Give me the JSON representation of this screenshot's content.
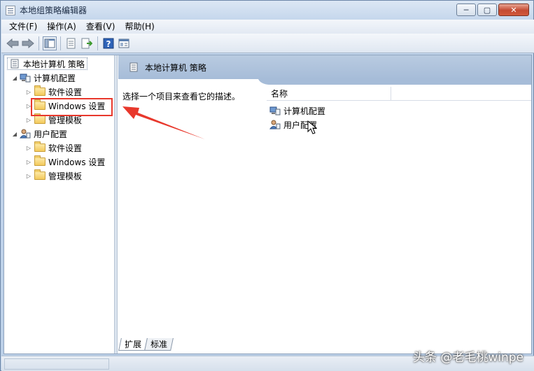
{
  "window": {
    "title": "本地组策略编辑器",
    "minimize": "─",
    "maximize": "▢",
    "close": "✕"
  },
  "menu": {
    "items": [
      "文件(F)",
      "操作(A)",
      "查看(V)",
      "帮助(H)"
    ]
  },
  "toolbar": {
    "icons": [
      "back-arrow-icon",
      "forward-arrow-icon",
      "show-hide-tree-icon",
      "properties-icon",
      "export-list-icon",
      "help-icon",
      "console-icon"
    ]
  },
  "tree": {
    "root": "本地计算机 策略",
    "computer_config": "计算机配置",
    "computer_children": [
      "软件设置",
      "Windows 设置",
      "管理模板"
    ],
    "user_config": "用户配置",
    "user_children": [
      "软件设置",
      "Windows 设置",
      "管理模板"
    ]
  },
  "right": {
    "header_title": "本地计算机 策略",
    "description": "选择一个项目来查看它的描述。",
    "column_name": "名称",
    "items": [
      "计算机配置",
      "用户配置"
    ]
  },
  "tabs": [
    "扩展",
    "标准"
  ],
  "watermark": "头条 @老毛桃winpe",
  "colors": {
    "highlight_box": "#e8382c",
    "header_bar": "#a6bcd8"
  }
}
